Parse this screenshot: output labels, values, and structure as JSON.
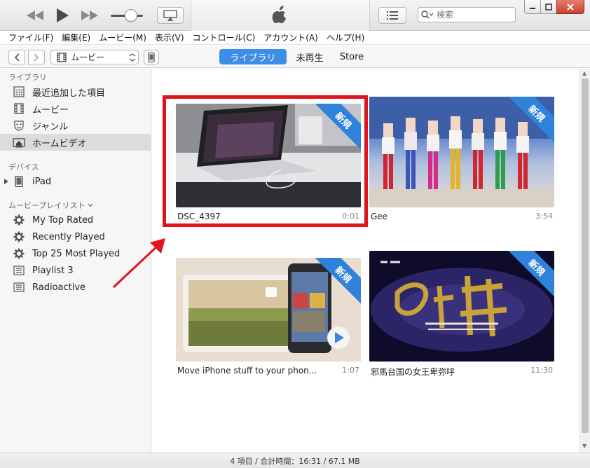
{
  "window": {
    "search_placeholder": "検索"
  },
  "menu": [
    "ファイル(F)",
    "編集(E)",
    "ムービー(M)",
    "表示(V)",
    "コントロール(C)",
    "アカウント(A)",
    "ヘルプ(H)"
  ],
  "navbar": {
    "media_select": "ムービー",
    "tabs": {
      "library": "ライブラリ",
      "unplayed": "未再生",
      "store": "Store"
    }
  },
  "sidebar": {
    "library_header": "ライブラリ",
    "library_items": [
      "最近追加した項目",
      "ムービー",
      "ジャンル",
      "ホームビデオ"
    ],
    "devices_header": "デバイス",
    "device": "iPad",
    "playlists_header": "ムービープレイリスト",
    "playlists": [
      "My Top Rated",
      "Recently Played",
      "Top 25 Most Played",
      "Playlist 3",
      "Radioactive"
    ]
  },
  "content": {
    "badge": "新規",
    "videos": [
      {
        "title": "DSC_4397",
        "duration": "0:01"
      },
      {
        "title": "Gee",
        "duration": "3:54"
      },
      {
        "title": "Move iPhone stuff to your phon...",
        "duration": "1:07"
      },
      {
        "title": "邪馬台国の女王卑弥呼",
        "duration": "11:30"
      }
    ]
  },
  "status": "4 項目 / 合計時間：16:31 / 67.1 MB",
  "colors": {
    "accent": "#3d8ee6",
    "badge": "#2f82da",
    "annotation": "#e0141b"
  }
}
